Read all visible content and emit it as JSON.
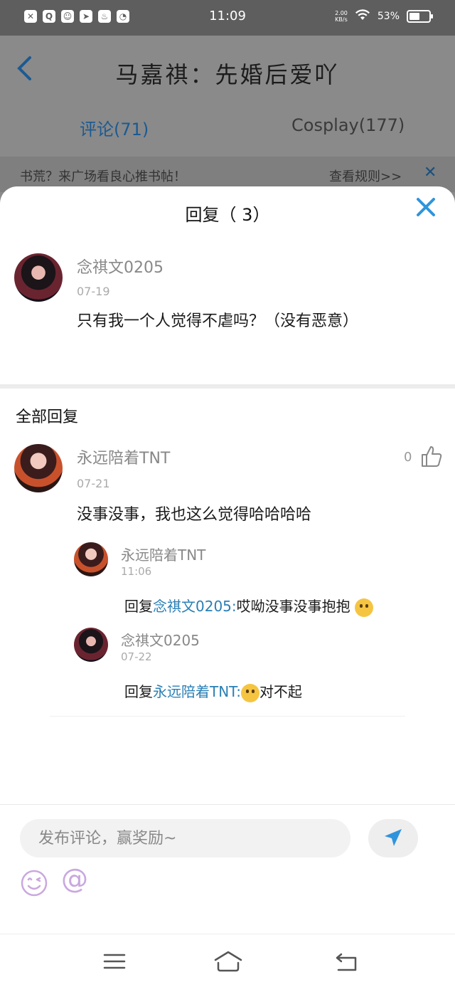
{
  "status_bar": {
    "time": "11:09",
    "speed_value": "2.00",
    "speed_unit": "KB/s",
    "battery": "53%",
    "battery_level": 0.53,
    "left_icons": [
      "notification-x-icon",
      "search-icon",
      "app-icon",
      "send-icon",
      "flame-icon",
      "compass-icon"
    ]
  },
  "header": {
    "title": "马嘉祺：先婚后爱吖"
  },
  "tabs": [
    {
      "label": "评论(71)",
      "active": true
    },
    {
      "label": "Cosplay(177)",
      "active": false
    }
  ],
  "notice": {
    "text": "书荒？来广场看良心推书帖！",
    "link": "查看规则>>"
  },
  "sheet": {
    "title": "回复（ 3）",
    "original": {
      "name": "念祺文0205",
      "date": "07-19",
      "content": "只有我一个人觉得不虐吗？（没有恶意）"
    },
    "section_title": "全部回复",
    "reply": {
      "name": "永远陪着TNT",
      "date": "07-21",
      "likes": "0",
      "content": "没事没事，我也这么觉得哈哈哈哈"
    },
    "sub_replies": [
      {
        "name": "永远陪着TNT",
        "date": "11:06",
        "prefix": "回复",
        "mention": "念祺文0205:",
        "text": "哎呦没事没事抱抱"
      },
      {
        "name": "念祺文0205",
        "date": "07-22",
        "prefix": "回复",
        "mention": "永远陪着TNT:",
        "text": "对不起"
      }
    ]
  },
  "input": {
    "placeholder": "发布评论，赢奖励~"
  },
  "colors": {
    "accent": "#2f94dc",
    "mention": "#2a7fb5",
    "tab_active": "#1c5a92"
  }
}
